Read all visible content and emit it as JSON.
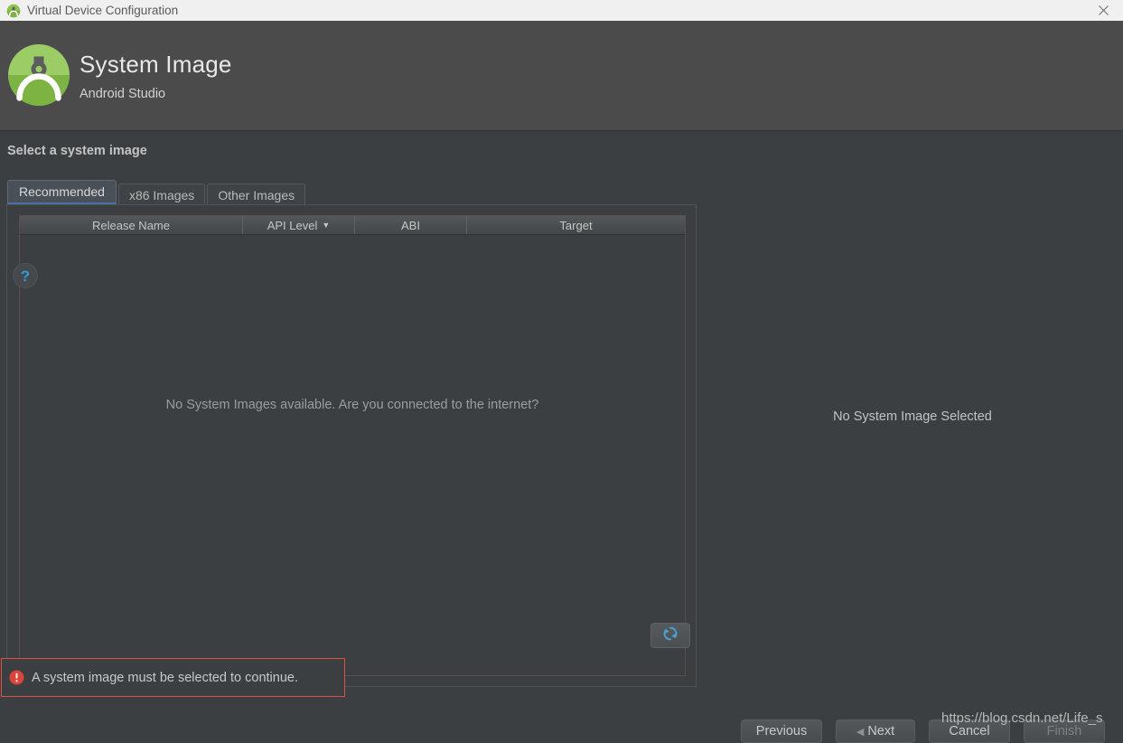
{
  "window": {
    "title": "Virtual Device Configuration",
    "app_icon": "android-studio-icon",
    "close_icon": "close-icon"
  },
  "header": {
    "logo": "android-studio-logo",
    "title": "System Image",
    "subtitle": "Android Studio"
  },
  "main": {
    "section_title": "Select a system image",
    "tabs": [
      {
        "label": "Recommended",
        "selected": true
      },
      {
        "label": "x86 Images",
        "selected": false
      },
      {
        "label": "Other Images",
        "selected": false
      }
    ],
    "table": {
      "columns": [
        {
          "label": "Release Name",
          "sorted": false
        },
        {
          "label": "API Level",
          "sorted": true,
          "sort_icon": "caret-down-icon",
          "sort_caret": "▼"
        },
        {
          "label": "ABI",
          "sorted": false
        },
        {
          "label": "Target",
          "sorted": false
        }
      ],
      "rows": [],
      "empty_message": "No System Images available. Are you connected to the internet?"
    },
    "refresh_button": {
      "icon": "refresh-icon",
      "label": ""
    },
    "preview": {
      "message": "No System Image Selected"
    }
  },
  "validation": {
    "icon": "error-icon",
    "message": "A system image must be selected to continue.",
    "border_color": "#e0503a"
  },
  "footer": {
    "help_icon": "?",
    "buttons": [
      {
        "label": "Previous",
        "enabled": true
      },
      {
        "label": "Next",
        "enabled": true,
        "caret": "◀"
      },
      {
        "label": "Cancel",
        "enabled": true
      },
      {
        "label": "Finish",
        "enabled": false
      }
    ]
  },
  "watermark": {
    "text": "https://blog.csdn.net/Life_s"
  },
  "colors": {
    "window_bg": "#3c3f41",
    "header_bg": "#4b4b4b",
    "titlebar_bg": "#f0f0f0",
    "accent_blue": "#4c6fa5",
    "error_red": "#e0503a",
    "android_green": "#8bc34a",
    "refresh_blue": "#4a90c4"
  }
}
